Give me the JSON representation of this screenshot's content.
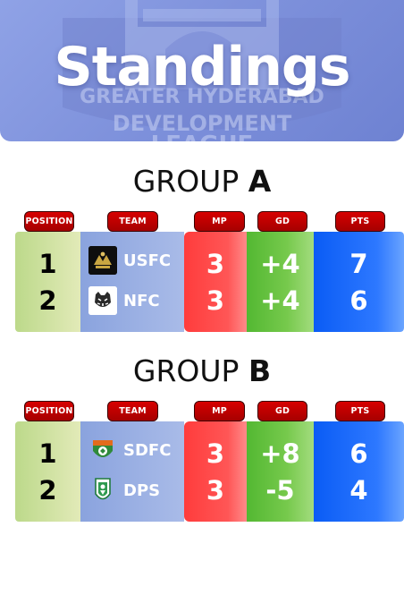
{
  "header": {
    "title": "Standings",
    "background_text": [
      "GREATER HYDERABAD",
      "DEVELOPMENT",
      "LEAGUE"
    ]
  },
  "columns": {
    "position": "POSITION",
    "team": "TEAM",
    "mp": "MP",
    "gd": "GD",
    "pts": "PTS"
  },
  "groups": [
    {
      "label": "GROUP",
      "letter": "A",
      "rows": [
        {
          "position": "1",
          "team": "USFC",
          "logo": "usfc-logo",
          "mp": "3",
          "gd": "+4",
          "pts": "7"
        },
        {
          "position": "2",
          "team": "NFC",
          "logo": "tiger-logo",
          "mp": "3",
          "gd": "+4",
          "pts": "6"
        }
      ]
    },
    {
      "label": "GROUP",
      "letter": "B",
      "rows": [
        {
          "position": "1",
          "team": "SDFC",
          "logo": "sdfc-crest",
          "mp": "3",
          "gd": "+8",
          "pts": "6"
        },
        {
          "position": "2",
          "team": "DPS",
          "logo": "dps-crest",
          "mp": "3",
          "gd": "-5",
          "pts": "4"
        }
      ]
    }
  ],
  "colors": {
    "pill": "#c40000",
    "position_col": "#c9de9a",
    "team_col": "#8ea6df",
    "mp_col": "#ff4545",
    "gd_col": "#5cbc38",
    "pts_col": "#1666fa"
  }
}
